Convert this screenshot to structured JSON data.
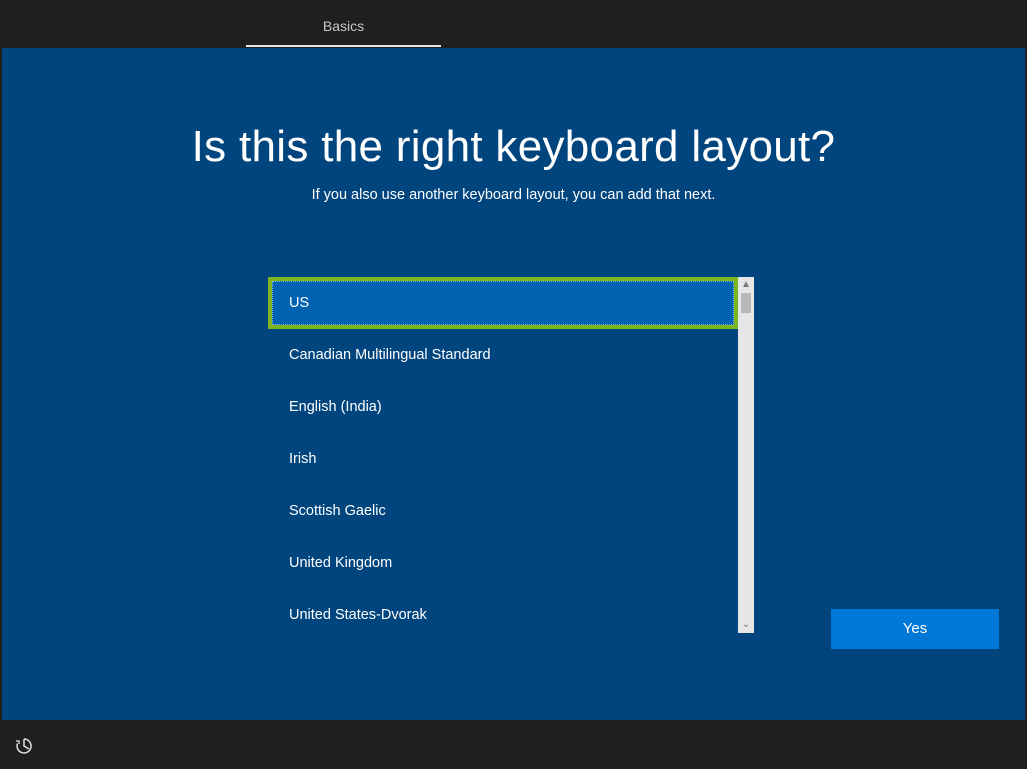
{
  "header": {
    "tab_label": "Basics"
  },
  "main": {
    "title": "Is this the right keyboard layout?",
    "subtitle": "If you also use another keyboard layout, you can add that next.",
    "layouts": [
      "US",
      "Canadian Multilingual Standard",
      "English (India)",
      "Irish",
      "Scottish Gaelic",
      "United Kingdom",
      "United States-Dvorak"
    ],
    "selected_layout": "US",
    "yes_label": "Yes"
  },
  "footer": {
    "accessibility_icon": "ease-of-access-icon"
  },
  "colors": {
    "background": "#00457d",
    "selected_item": "#0063b1",
    "focus_outline": "#7cb51e",
    "button": "#0078d7",
    "bars": "#1f1f1f"
  }
}
